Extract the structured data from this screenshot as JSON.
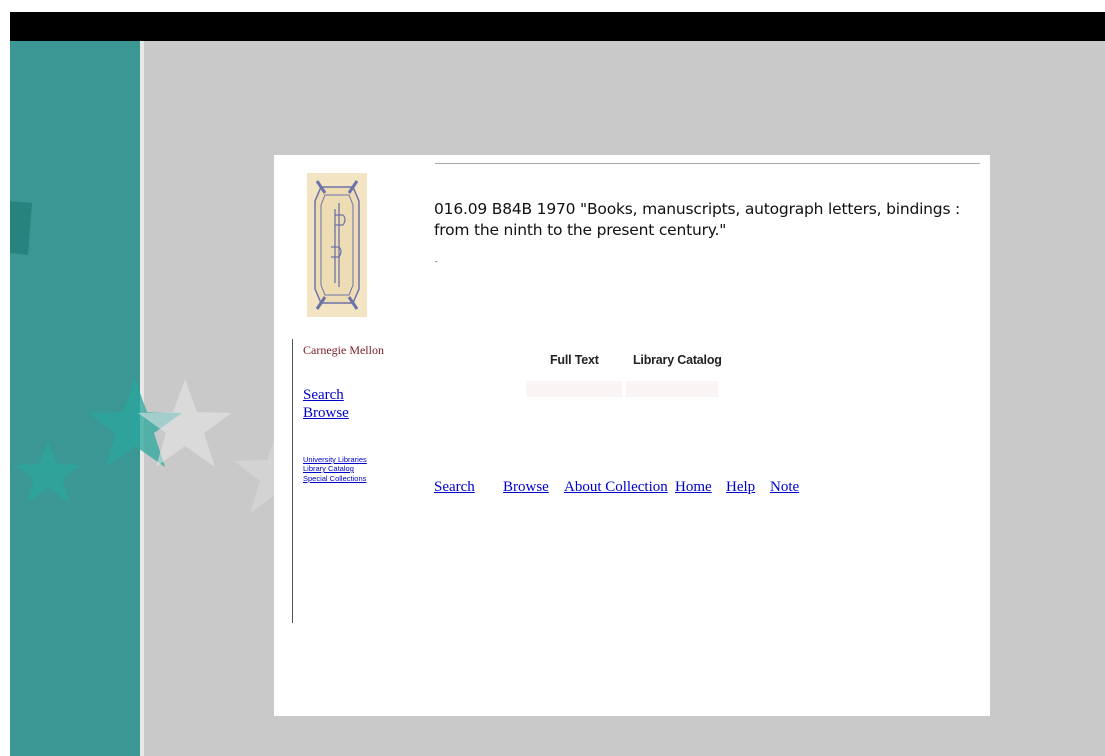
{
  "record": {
    "title": "016.09 B84B 1970 \"Books, manuscripts, autograph letters, bindings : from the ninth to the present century.\"",
    "mark": "-"
  },
  "sidebar": {
    "brand": "Carnegie Mellon",
    "nav": [
      "Search",
      "Browse"
    ],
    "links": [
      "University Libraries",
      "Library Catalog",
      "Special Collections"
    ]
  },
  "tabs": [
    "Full Text",
    "Library Catalog"
  ],
  "footer_nav": [
    "Search",
    "Browse",
    "About Collection",
    "Home",
    "Help",
    "Note"
  ],
  "colors": {
    "teal": "#3a9793",
    "gray": "#c9c9c9",
    "link": "#0000cc",
    "brand": "#7a1a25",
    "logo_bg": "#f3e4c4"
  },
  "icons": {
    "logo": "library-bookplate-logo"
  }
}
